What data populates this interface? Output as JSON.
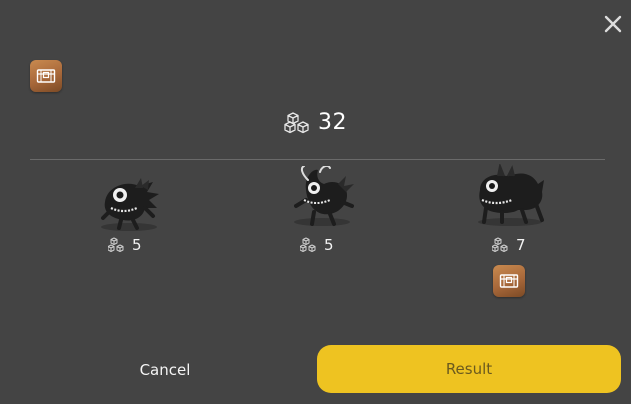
{
  "icons": {
    "close": "close-icon",
    "chest": "chest-icon",
    "cubes": "cubes-icon"
  },
  "colors": {
    "background": "#444444",
    "result_button": "#eec321",
    "chest_badge": "#b2723f"
  },
  "total": {
    "value": "32"
  },
  "monsters": [
    {
      "cost": "5",
      "has_chest": false
    },
    {
      "cost": "5",
      "has_chest": false
    },
    {
      "cost": "7",
      "has_chest": true
    }
  ],
  "buttons": {
    "cancel_label": "Cancel",
    "result_label": "Result"
  }
}
